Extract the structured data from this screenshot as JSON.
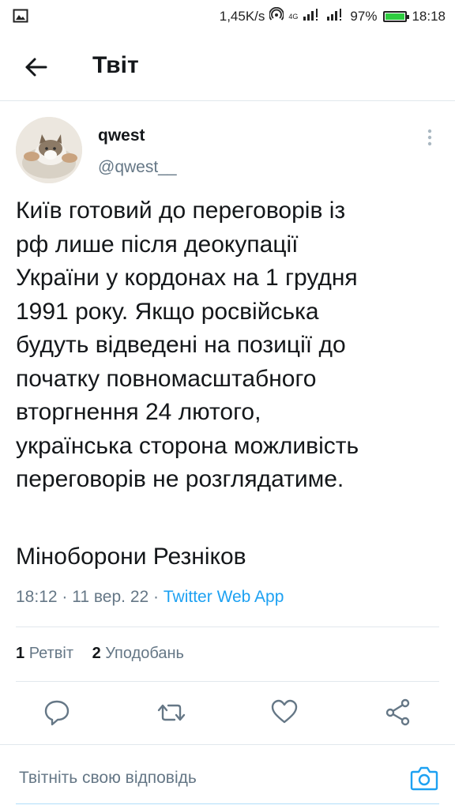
{
  "status_bar": {
    "speed": "1,45K/s",
    "network": "4G",
    "battery": "97%",
    "battery_level": 0.97,
    "time": "18:18"
  },
  "header": {
    "title": "Твіт",
    "back_icon": "arrow-left-icon"
  },
  "tweet": {
    "display_name": "qwest",
    "handle": "@qwest__",
    "text": "Київ готовий до переговорів із\nрф лише після деокупації\nУкраїни у кордонах на 1 грудня\n1991 року. Якщо росвійська\nбудуть відведені на позиції до\nпочатку повномасштабного\nвторгнення 24 лютого,\nукраїнська сторона можливість\nпереговорів не розглядатиме.",
    "signature": "Міноборони Резніков",
    "time": "18:12",
    "date": "11 вер. 22",
    "separator": "·",
    "source": "Twitter Web App",
    "retweets_count": "1",
    "retweets_label": "Ретвіт",
    "likes_count": "2",
    "likes_label": "Уподобань"
  },
  "actions": [
    "reply-icon",
    "retweet-icon",
    "like-icon",
    "share-icon"
  ],
  "reply_bar": {
    "placeholder": "Твітніть свою відповідь",
    "icon": "camera-icon"
  },
  "colors": {
    "accent": "#1da1f2",
    "muted": "#657786",
    "text": "#14171a",
    "battery": "#2ecc40"
  }
}
